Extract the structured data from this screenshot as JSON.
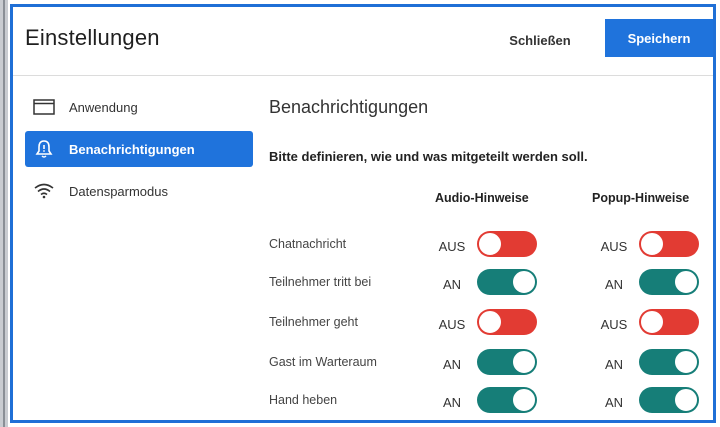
{
  "dialog": {
    "title": "Einstellungen",
    "close_label": "Schließen",
    "save_label": "Speichern"
  },
  "sidebar": {
    "items": [
      {
        "label": "Anwendung",
        "icon": "window-icon",
        "active": false
      },
      {
        "label": "Benachrichtigungen",
        "icon": "bell-icon",
        "active": true
      },
      {
        "label": "Datensparmodus",
        "icon": "wifi-icon",
        "active": false
      }
    ]
  },
  "main": {
    "section_title": "Benachrichtigungen",
    "instruction": "Bitte definieren, wie und was mitgeteilt werden soll.",
    "columns": [
      "Audio-Hinweise",
      "Popup-Hinweise"
    ],
    "rows": [
      {
        "label": "Chatnachricht",
        "audio": "AUS",
        "popup": "AUS"
      },
      {
        "label": "Teilnehmer tritt bei",
        "audio": "AN",
        "popup": "AN"
      },
      {
        "label": "Teilnehmer geht",
        "audio": "AUS",
        "popup": "AUS"
      },
      {
        "label": "Gast im Warteraum",
        "audio": "AN",
        "popup": "AN"
      },
      {
        "label": "Hand heben",
        "audio": "AN",
        "popup": "AN"
      }
    ]
  },
  "colors": {
    "accent": "#1f73dc",
    "toggle_on": "#167e78",
    "toggle_off": "#e23b33",
    "frame_border": "#1f6fd6"
  }
}
